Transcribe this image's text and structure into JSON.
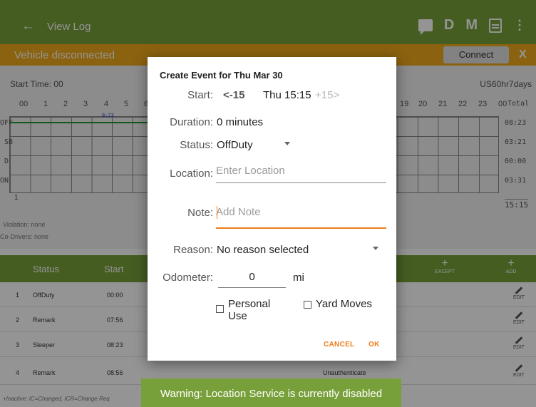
{
  "app": {
    "title": "View Log",
    "back_icon": "arrow-left-icon",
    "actions": [
      {
        "name": "message",
        "icon": "message-icon"
      },
      {
        "name": "d",
        "label": "D"
      },
      {
        "name": "m",
        "label": "M"
      },
      {
        "name": "export",
        "icon": "export-sheet-icon"
      },
      {
        "name": "overflow",
        "label": "⋮"
      }
    ],
    "colors": {
      "appbar": "#78a03a",
      "banner": "#f0a91a",
      "accent": "#ef7d1a",
      "graph_line": "#1f9a2b"
    }
  },
  "banner": {
    "text": "Vehicle disconnected",
    "connect_label": "Connect",
    "close_label": "X"
  },
  "graph": {
    "start_time": "Start Time: 00",
    "ruleset": "US60hr7days",
    "hours": [
      "00",
      "1",
      "2",
      "3",
      "4",
      "5",
      "6",
      "19",
      "20",
      "21",
      "22",
      "23",
      "00"
    ],
    "total_label": "Total",
    "rows": [
      {
        "label": "OFF",
        "total": "08:23"
      },
      {
        "label": "SB",
        "total": "03:21"
      },
      {
        "label": "D",
        "total": "00:00"
      },
      {
        "label": "ON",
        "total": "03:31"
      }
    ],
    "grand_total": "15:15",
    "segment_label": "8:23",
    "footer_num": "1",
    "violation": "Violation: none",
    "codrivers": "Co-Drivers: none"
  },
  "table": {
    "headers": {
      "status": "Status",
      "start": "Start"
    },
    "except_label": "EXCEPT",
    "add_label": "ADD",
    "rows": [
      {
        "num": "1",
        "status": "OffDuty",
        "start": "00:00",
        "extra": "",
        "edit": "EDIT"
      },
      {
        "num": "2",
        "status": "Remark",
        "start": "07:56",
        "extra": "",
        "edit": "EDIT"
      },
      {
        "num": "3",
        "status": "Sleeper",
        "start": "08:23",
        "extra": "",
        "edit": "EDIT"
      },
      {
        "num": "4",
        "status": "Remark",
        "start": "08:56",
        "extra": "Unauthenticate",
        "edit": "EDIT"
      }
    ],
    "legend": "+Inactive: IC=Changed, ICR=Change Req"
  },
  "dialog": {
    "title": "Create Event for Thu Mar 30",
    "start_label": "Start:",
    "start_prev": "<-15",
    "start_value": "Thu 15:15",
    "start_next": "+15>",
    "duration_label": "Duration:",
    "duration_value": "0 minutes",
    "status_label": "Status:",
    "status_value": "OffDuty",
    "location_label": "Location:",
    "location_placeholder": "Enter Location",
    "note_label": "Note:",
    "note_placeholder": "Add Note",
    "reason_label": "Reason:",
    "reason_value": "No reason selected",
    "odometer_label": "Odometer:",
    "odometer_value": "0",
    "odometer_unit": "mi",
    "personal_use_label": "Personal Use",
    "yard_moves_label": "Yard Moves",
    "cancel_label": "CANCEL",
    "ok_label": "OK"
  },
  "toast": {
    "text": "Warning: Location Service is currently disabled"
  }
}
